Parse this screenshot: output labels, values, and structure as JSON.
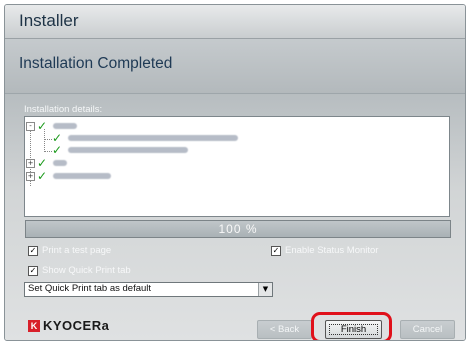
{
  "window": {
    "title": "Installer"
  },
  "header": {
    "title": "Installation Completed"
  },
  "details": {
    "label": "Installation details:"
  },
  "tree": {
    "items": [
      {
        "expander": "-",
        "level": 0,
        "status": "check-icon"
      },
      {
        "expander": "",
        "level": 1,
        "status": "check-icon"
      },
      {
        "expander": "",
        "level": 1,
        "status": "check-icon"
      },
      {
        "expander": "+",
        "level": 0,
        "status": "check-icon"
      },
      {
        "expander": "+",
        "level": 0,
        "status": "check-icon"
      }
    ]
  },
  "progress": {
    "text": "100 %",
    "value": 100
  },
  "options": {
    "print_test_page": {
      "label": "Print a test page",
      "checked": true
    },
    "enable_status_monitor": {
      "label": "Enable Status Monitor",
      "checked": true
    },
    "show_quick_print_tab": {
      "label": "Show Quick Print tab",
      "checked": true
    }
  },
  "quick_print_select": {
    "value": "Set Quick Print tab as default"
  },
  "brand": {
    "name": "KYOCERa",
    "color": "#d8202a"
  },
  "buttons": {
    "back": "< Back",
    "finish": "Finish",
    "cancel": "Cancel"
  },
  "highlight": {
    "color": "#e0101a"
  }
}
